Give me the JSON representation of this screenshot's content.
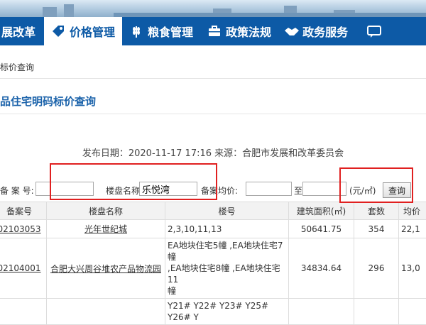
{
  "nav": {
    "items": [
      {
        "label": "展改革",
        "icon": "none"
      },
      {
        "label": "价格管理",
        "icon": "price-tag-icon",
        "active": true
      },
      {
        "label": "粮食管理",
        "icon": "wheat-icon"
      },
      {
        "label": "政策法规",
        "icon": "briefcase-icon"
      },
      {
        "label": "政务服务",
        "icon": "handshake-icon"
      }
    ]
  },
  "breadcrumb": "标价查询",
  "page_title": "品住宅明码标价查询",
  "publish_info": "发布日期：2020-11-17 17:16    来源：合肥市发展和改革委员会",
  "search": {
    "record_label": "备 案 号:",
    "record_value": "",
    "name_label": "楼盘名称:",
    "name_value": "乐悦湾",
    "avg_label": "备案均价:",
    "avg_from": "",
    "to_label": "至",
    "avg_to": "",
    "unit": "(元/㎡)",
    "query_button": "查询"
  },
  "table": {
    "headers": [
      "备案号",
      "楼盘名称",
      "楼号",
      "建筑面积(㎡)",
      "套数",
      "均价"
    ],
    "rows": [
      {
        "record": "02103053",
        "name": "光年世纪城",
        "buildings": "2,3,10,11,13",
        "area": "50641.75",
        "count": "354",
        "avg": "22,1"
      },
      {
        "record": "02104001",
        "name": "合肥大兴周谷堆农产品物流园",
        "buildings": "EA地块住宅5幢 ,EA地块住宅7幢\n,EA地块住宅8幢 ,EA地块住宅11\n幢",
        "area": "34834.64",
        "count": "296",
        "avg": "13,0"
      },
      {
        "record": "",
        "name": "",
        "buildings": "Y21# Y22# Y23# Y25# Y26# Y",
        "area": "",
        "count": "",
        "avg": ""
      }
    ]
  },
  "colors": {
    "nav_bg": "#0d5aa6",
    "title": "#1a62aa",
    "highlight": "#e02020"
  }
}
